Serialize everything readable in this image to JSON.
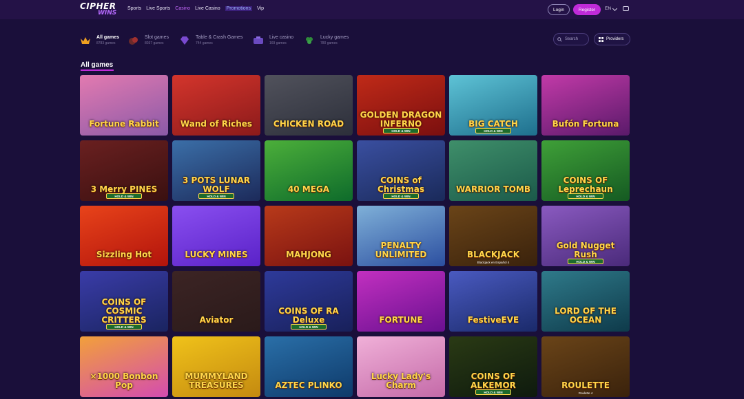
{
  "brand": {
    "line1": "CIPHER",
    "line2": "WINS"
  },
  "nav": [
    "Sports",
    "Live Sports",
    "Casino",
    "Live Casino",
    "Promotions",
    "Vip"
  ],
  "header": {
    "login": "Login",
    "register": "Register",
    "lang": "EN"
  },
  "categories": [
    {
      "name": "All games",
      "count": "8783 games",
      "icon": "crown-icon"
    },
    {
      "name": "Slot games",
      "count": "8037 games",
      "icon": "slot-icon"
    },
    {
      "name": "Table & Crash Games",
      "count": "744 games",
      "icon": "diamond-icon"
    },
    {
      "name": "Live casino",
      "count": "169 games",
      "icon": "live-icon"
    },
    {
      "name": "Lucky games",
      "count": "780 games",
      "icon": "clover-icon"
    }
  ],
  "search": {
    "label": "Search"
  },
  "providers": {
    "label": "Providers"
  },
  "section": {
    "title": "All games"
  },
  "games": [
    {
      "title": "Fortune Rabbit",
      "badge": "",
      "sub": "",
      "colors": [
        "#8a5aa8",
        "#e37ab0"
      ]
    },
    {
      "title": "Wand of Riches",
      "badge": "",
      "sub": "",
      "colors": [
        "#8b1a1a",
        "#d4352c"
      ]
    },
    {
      "title": "CHICKEN ROAD",
      "badge": "",
      "sub": "",
      "colors": [
        "#2c2f3a",
        "#51525c"
      ]
    },
    {
      "title": "GOLDEN DRAGON INFERNO",
      "badge": "HOLD & WIN",
      "sub": "",
      "colors": [
        "#7a0f0f",
        "#c02a18"
      ]
    },
    {
      "title": "BIG CATCH",
      "badge": "HOLD & WIN",
      "sub": "",
      "colors": [
        "#1e6f8d",
        "#5ec3d6"
      ]
    },
    {
      "title": "Bufón Fortuna",
      "badge": "",
      "sub": "",
      "colors": [
        "#5a1a6a",
        "#c23aa8"
      ]
    },
    {
      "title": "3 Merry PINES",
      "badge": "HOLD & WIN",
      "sub": "",
      "colors": [
        "#3a1010",
        "#6a2020"
      ]
    },
    {
      "title": "3 POTS LUNAR WOLF",
      "badge": "HOLD & WIN",
      "sub": "",
      "colors": [
        "#1c2a5a",
        "#3b6fa8"
      ]
    },
    {
      "title": "40 MEGA",
      "badge": "",
      "sub": "",
      "colors": [
        "#0e6b2b",
        "#4caf3a"
      ]
    },
    {
      "title": "COINS of Christmas",
      "badge": "HOLD & WIN",
      "sub": "",
      "colors": [
        "#1a2a5a",
        "#3a4fa0"
      ]
    },
    {
      "title": "WARRIOR TOMB",
      "badge": "",
      "sub": "",
      "colors": [
        "#1b5a4a",
        "#3f8f6a"
      ]
    },
    {
      "title": "COINS OF Leprechaun",
      "badge": "HOLD & WIN",
      "sub": "",
      "colors": [
        "#155a22",
        "#3fa038"
      ]
    },
    {
      "title": "Sizzling Hot",
      "badge": "",
      "sub": "",
      "colors": [
        "#b2140c",
        "#e8431a"
      ]
    },
    {
      "title": "LUCKY MINES",
      "badge": "",
      "sub": "",
      "colors": [
        "#5a22c8",
        "#8a4ff0"
      ]
    },
    {
      "title": "MAHJONG",
      "badge": "",
      "sub": "",
      "colors": [
        "#7a1210",
        "#b83a1a"
      ]
    },
    {
      "title": "PENALTY UNLIMITED",
      "badge": "",
      "sub": "",
      "colors": [
        "#2c4fa0",
        "#7fb0d8"
      ]
    },
    {
      "title": "BLACKJACK",
      "badge": "",
      "sub": "Blackjack en Español 4",
      "colors": [
        "#3a220c",
        "#6a4418"
      ]
    },
    {
      "title": "Gold Nugget Rush",
      "badge": "HOLD & WIN",
      "sub": "",
      "colors": [
        "#4a2a7a",
        "#8a5ac0"
      ]
    },
    {
      "title": "COINS OF COSMIC CRITTERS",
      "badge": "HOLD & WIN",
      "sub": "",
      "colors": [
        "#1a2460",
        "#3a3ca8"
      ]
    },
    {
      "title": "Aviator",
      "badge": "",
      "sub": "",
      "colors": [
        "#2a1a1a",
        "#3c2424"
      ]
    },
    {
      "title": "COINS OF RA Deluxe",
      "badge": "HOLD & WIN",
      "sub": "",
      "colors": [
        "#18205a",
        "#2e3a9a"
      ]
    },
    {
      "title": "FORTUNE",
      "badge": "",
      "sub": "",
      "colors": [
        "#6a1090",
        "#c230c0"
      ]
    },
    {
      "title": "FestiveEVE",
      "badge": "",
      "sub": "",
      "colors": [
        "#1a2a6a",
        "#4a5ac0"
      ]
    },
    {
      "title": "LORD OF THE OCEAN",
      "badge": "",
      "sub": "",
      "colors": [
        "#0e3a4a",
        "#2f7a8a"
      ]
    },
    {
      "title": "×1000 Bonbon Pop",
      "badge": "",
      "sub": "",
      "colors": [
        "#d44cb0",
        "#f2a03a"
      ]
    },
    {
      "title": "MUMMYLAND TREASURES",
      "badge": "",
      "sub": "",
      "colors": [
        "#c48a10",
        "#f0c21a"
      ]
    },
    {
      "title": "AZTEC PLINKO",
      "badge": "",
      "sub": "",
      "colors": [
        "#0e3a6a",
        "#2a6fa8"
      ]
    },
    {
      "title": "Lucky Lady's Charm",
      "badge": "",
      "sub": "",
      "colors": [
        "#c46aa8",
        "#f0b0d8"
      ]
    },
    {
      "title": "COINS OF ALKEMOR",
      "badge": "HOLD & WIN",
      "sub": "",
      "colors": [
        "#0e1a0e",
        "#2a3a14"
      ]
    },
    {
      "title": "ROULETTE",
      "badge": "",
      "sub": "Roulette 4",
      "colors": [
        "#3a220c",
        "#6a4418"
      ]
    }
  ]
}
